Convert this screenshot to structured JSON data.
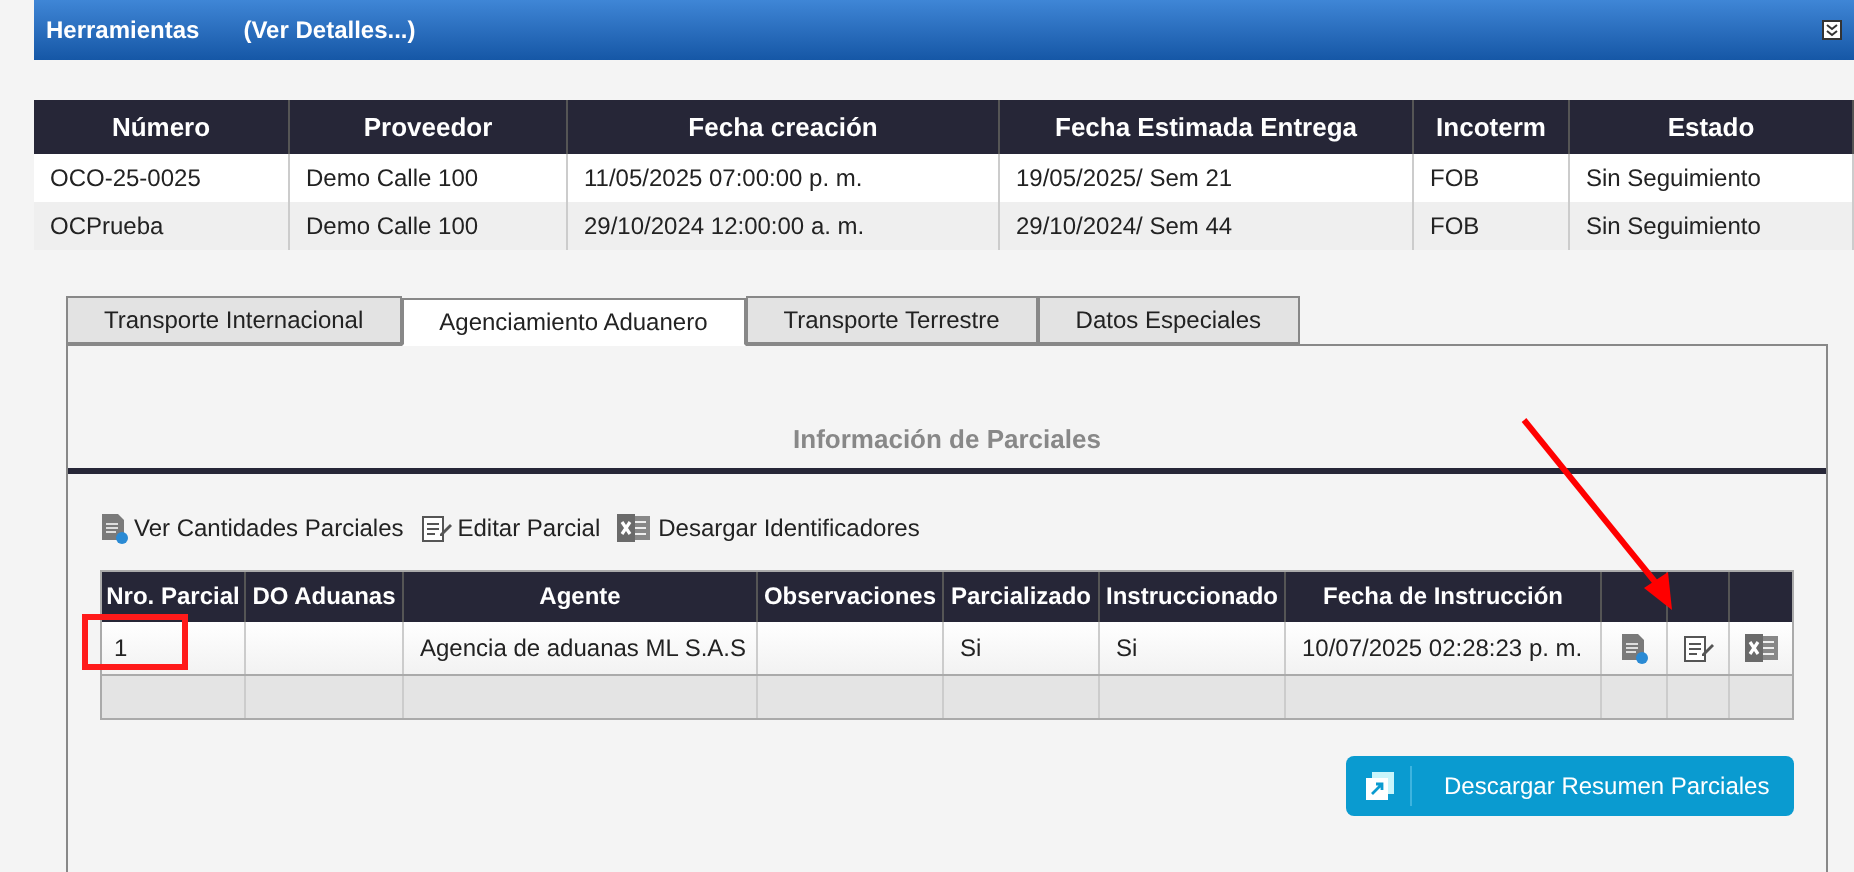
{
  "header": {
    "title": "Herramientas",
    "link": "(Ver Detalles...)"
  },
  "orders": {
    "columns": [
      "Número",
      "Proveedor",
      "Fecha creación",
      "Fecha Estimada Entrega",
      "Incoterm",
      "Estado"
    ],
    "rows": [
      [
        "OCO-25-0025",
        "Demo Calle 100",
        "11/05/2025 07:00:00 p. m.",
        "19/05/2025/ Sem 21",
        "FOB",
        "Sin Seguimiento"
      ],
      [
        "OCPrueba",
        "Demo Calle 100",
        "29/10/2024 12:00:00 a. m.",
        "29/10/2024/ Sem 44",
        "FOB",
        "Sin Seguimiento"
      ]
    ]
  },
  "tabs": [
    {
      "label": "Transporte Internacional",
      "selected": false
    },
    {
      "label": "Agenciamiento Aduanero",
      "selected": true
    },
    {
      "label": "Transporte Terrestre",
      "selected": false
    },
    {
      "label": "Datos Especiales",
      "selected": false
    }
  ],
  "section_title": "Información de Parciales",
  "toolbar": [
    {
      "kind": "view",
      "label": "Ver Cantidades Parciales"
    },
    {
      "kind": "edit",
      "label": "Editar Parcial"
    },
    {
      "kind": "excel",
      "label": "Desargar Identificadores"
    }
  ],
  "partials": {
    "columns": [
      "Nro. Parcial",
      "DO Aduanas",
      "Agente",
      "Observaciones",
      "Parcializado",
      "Instruccionado",
      "Fecha de Instrucción"
    ],
    "rows": [
      [
        "1",
        "",
        "Agencia de aduanas ML S.A.S",
        "",
        "Si",
        "Si",
        "10/07/2025 02:28:23 p. m."
      ]
    ]
  },
  "download_button": "Descargar Resumen Parciales"
}
